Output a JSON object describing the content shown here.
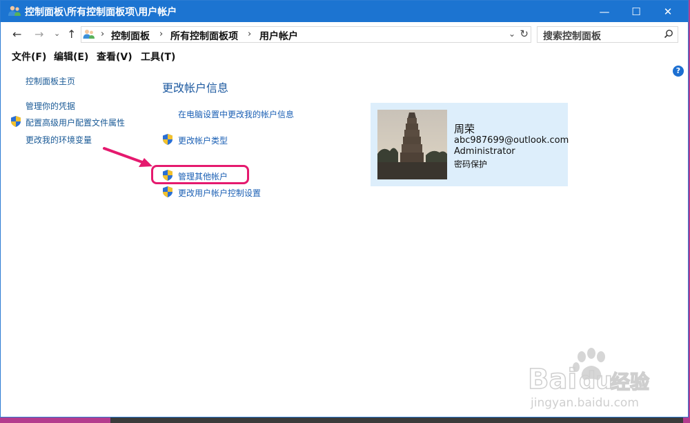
{
  "window": {
    "title": "控制面板\\所有控制面板项\\用户帐户",
    "controls": {
      "minimize": "—",
      "maximize": "☐",
      "close": "✕"
    }
  },
  "address": {
    "nav": {
      "back": "←",
      "forward": "→",
      "recent": "⌄",
      "up": "↑"
    },
    "breadcrumbs": [
      "控制面板",
      "所有控制面板项",
      "用户帐户"
    ],
    "separator": "›",
    "dropdown": "⌄",
    "refresh": "↻",
    "search_placeholder": "搜索控制面板"
  },
  "menu": [
    "文件(F)",
    "编辑(E)",
    "查看(V)",
    "工具(T)"
  ],
  "left_pane": {
    "home": "控制面板主页",
    "links": [
      "管理你的凭据",
      "配置高级用户配置文件属性",
      "更改我的环境变量"
    ]
  },
  "main": {
    "heading": "更改帐户信息",
    "links": [
      "在电脑设置中更改我的帐户信息",
      "更改帐户类型",
      "管理其他帐户",
      "更改用户帐户控制设置"
    ]
  },
  "account": {
    "name": "周荣",
    "email": "abc987699@outlook.com",
    "role": "Administrator",
    "password_status": "密码保护"
  },
  "help": "?",
  "colors": {
    "titlebar": "#1c74d1",
    "link": "#1a5fb4",
    "highlight": "#e5196e",
    "card": "#ddeefb"
  },
  "watermark": {
    "text": "Bai du 经验",
    "url": "jingyan.baidu.com"
  }
}
